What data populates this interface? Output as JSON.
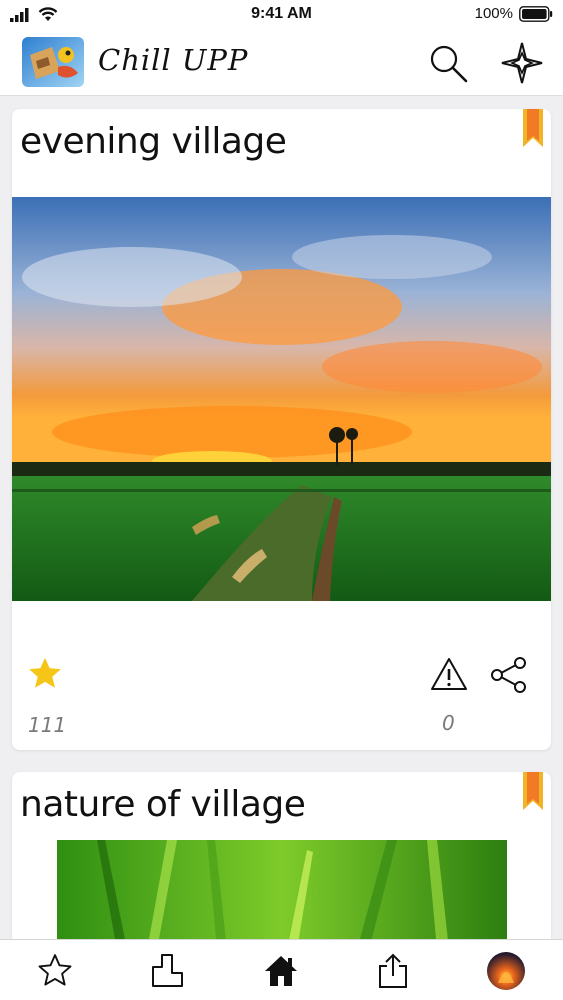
{
  "status_bar": {
    "time": "9:41 AM",
    "battery": "100%"
  },
  "header": {
    "app_name": "Chill UPP",
    "search_icon": "search-icon",
    "compass_icon": "compass-star-icon"
  },
  "posts": [
    {
      "title": "evening village",
      "image": "sunset-over-rice-fields",
      "likes": "111",
      "reports": "0"
    },
    {
      "title": "nature of village",
      "image": "green-grass-closeup"
    }
  ],
  "tab_bar": {
    "items": [
      "star-icon",
      "puzzle-icon",
      "home-icon",
      "upload-icon",
      "avatar"
    ],
    "active": "home-icon"
  },
  "colors": {
    "accent_gold": "#f5c518",
    "bookmark_orange": "#f08a24",
    "background": "#efeff1"
  }
}
